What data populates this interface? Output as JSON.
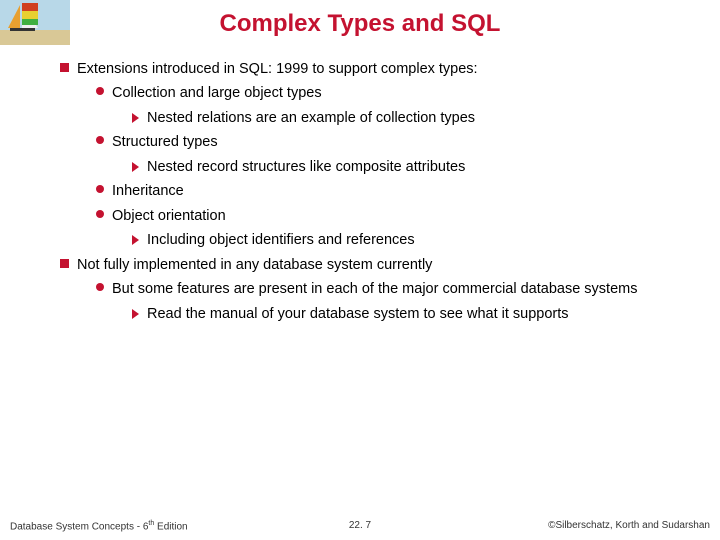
{
  "title": "Complex Types and SQL",
  "b1": "Extensions introduced in SQL: 1999 to support complex types:",
  "b1_1": "Collection and large object types",
  "b1_1_1": "Nested relations are an example of collection types",
  "b1_2": "Structured types",
  "b1_2_1": "Nested record structures like composite attributes",
  "b1_3": "Inheritance",
  "b1_4": "Object orientation",
  "b1_4_1": "Including object identifiers and references",
  "b2": "Not fully implemented in any database system currently",
  "b2_1": "But some features are present in each of the major commercial database systems",
  "b2_1_1": "Read the manual of your database system to see what it supports",
  "footer_left_pre": "Database System Concepts - 6",
  "footer_left_sup": "th",
  "footer_left_post": " Edition",
  "footer_center": "22. 7",
  "footer_right": "©Silberschatz, Korth and Sudarshan"
}
